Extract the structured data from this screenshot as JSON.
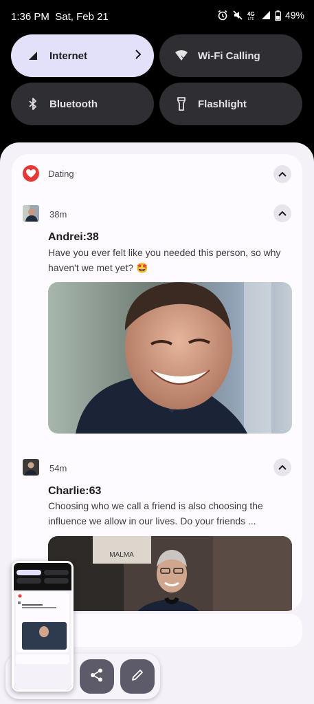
{
  "status_bar": {
    "time": "1:36 PM",
    "date": "Sat, Feb 21",
    "battery": "49%",
    "icons": [
      "alarm-icon",
      "mute-icon",
      "lte-icon",
      "signal-icon",
      "battery-icon"
    ]
  },
  "quick_settings": {
    "tiles": [
      {
        "label": "Internet",
        "icon": "signal-icon",
        "active": true
      },
      {
        "label": "Wi-Fi Calling",
        "icon": "wifi-calling-icon",
        "active": false
      },
      {
        "label": "Bluetooth",
        "icon": "bluetooth-icon",
        "active": false
      },
      {
        "label": "Flashlight",
        "icon": "flashlight-icon",
        "active": false
      }
    ]
  },
  "notification": {
    "app_name": "Dating",
    "app_color": "#e53935",
    "messages": [
      {
        "sender": "Andrei:38",
        "time": "38m",
        "text": "Have you ever felt like you needed this person, so why haven't we met yet? 🤩"
      },
      {
        "sender": "Charlie:63",
        "time": "54m",
        "text": "Choosing who we call a friend is also choosing the influence we allow in our lives. Do your friends ..."
      }
    ],
    "photo2_sign_text": "MALMA"
  },
  "screenshot_actions": {
    "share": "share-icon",
    "edit": "edit-icon"
  },
  "colors": {
    "shade_bg": "#f4f1f8",
    "active_tile": "#e3e0f9",
    "inactive_tile": "#2f2f33",
    "accent": "#e53935"
  }
}
